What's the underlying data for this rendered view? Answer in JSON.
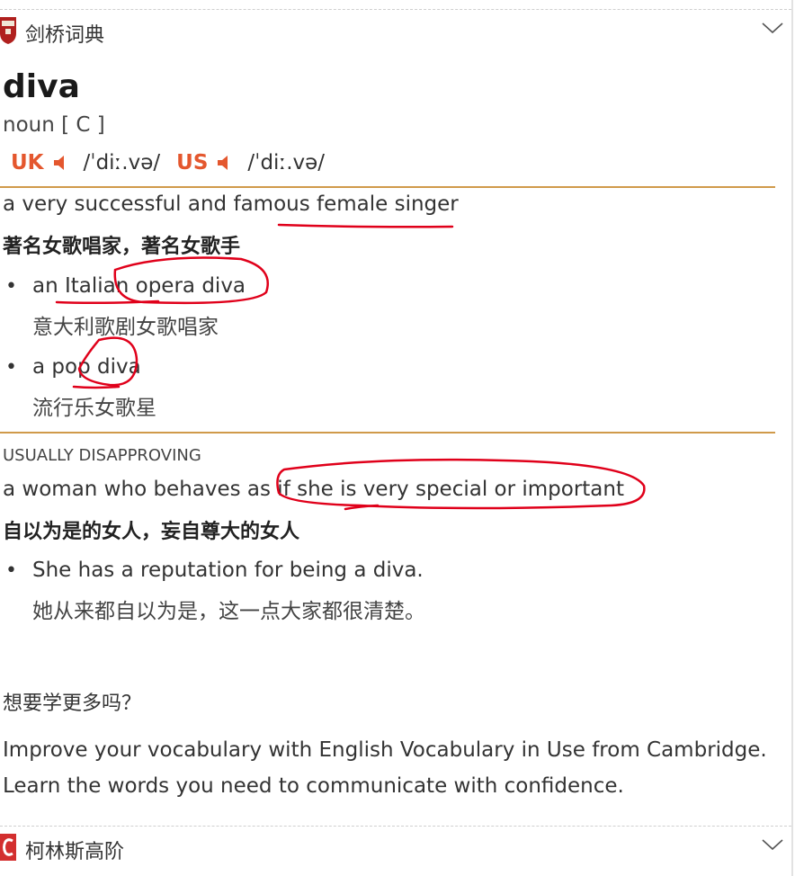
{
  "dictionaries": {
    "top": {
      "name": "剑桥词典",
      "icon": "cambridge-shield-icon"
    },
    "bottom": {
      "name": "柯林斯高阶",
      "icon": "collins-logo-icon"
    }
  },
  "entry": {
    "headword": "diva",
    "pos": "noun [ C ]",
    "uk_label": "UK",
    "uk_ipa": "/ˈdiː.və/",
    "us_label": "US",
    "us_ipa": "/ˈdiː.və/",
    "senses": [
      {
        "definition": "a very successful and famous female singer",
        "translation": "著名女歌唱家，著名女歌手",
        "examples": [
          {
            "en": "an Italian opera diva",
            "zh": "意大利歌剧女歌唱家"
          },
          {
            "en": "a pop diva",
            "zh": "流行乐女歌星"
          }
        ]
      },
      {
        "label": "USUALLY DISAPPROVING",
        "definition": "a woman who behaves as if she is very special or important",
        "translation": "自以为是的女人，妄自尊大的女人",
        "examples": [
          {
            "en": "She has a reputation for being a diva.",
            "zh": "她从来都自以为是，这一点大家都很清楚。"
          }
        ]
      }
    ]
  },
  "promo": {
    "title": "想要学更多吗？",
    "text": "Improve your vocabulary with English Vocabulary in Use from Cambridge. Learn the words you need to communicate with confidence."
  },
  "colors": {
    "accent": "#e4572e",
    "rule": "#d09a4a",
    "annotation": "#e0001a"
  }
}
